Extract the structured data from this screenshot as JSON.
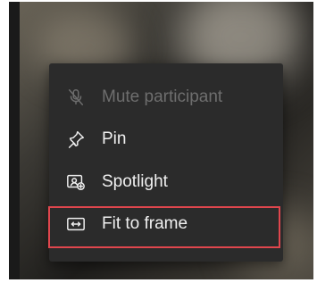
{
  "menu": {
    "items": [
      {
        "label": "Mute participant",
        "icon": "mic-off-icon",
        "enabled": false
      },
      {
        "label": "Pin",
        "icon": "pin-icon",
        "enabled": true
      },
      {
        "label": "Spotlight",
        "icon": "spotlight-icon",
        "enabled": true
      },
      {
        "label": "Fit to frame",
        "icon": "fit-to-frame-icon",
        "enabled": true
      }
    ],
    "highlighted_item": "Fit to frame"
  },
  "colors": {
    "menu_background": "#2b2b2b",
    "text": "#f0f0f0",
    "disabled_text": "#6e6e6e",
    "highlight_border": "#e0464d"
  }
}
